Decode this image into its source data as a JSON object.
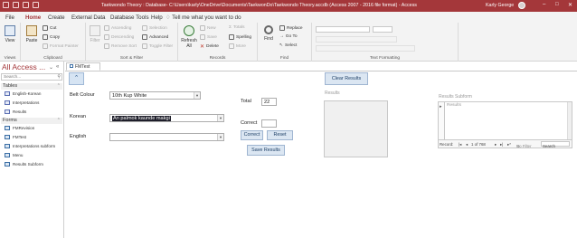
{
  "titlebar": {
    "title": "Taekwondo Theory : Database- C:\\Users\\karly\\OneDrive\\Documents\\TaekwonDo\\Taekwondo Theory.accdb (Access 2007 - 2016 file format) - Access",
    "user": "Karly George",
    "minimize": "–",
    "maximize": "□",
    "close": "✕"
  },
  "menu": {
    "tabs": [
      "File",
      "Home",
      "Create",
      "External Data",
      "Database Tools",
      "Help"
    ],
    "active": "Home",
    "tell_me": "Tell me what you want to do"
  },
  "ribbon": {
    "views": {
      "view": "View",
      "group": "Views"
    },
    "clipboard": {
      "paste": "Paste",
      "cut": "Cut",
      "copy": "Copy",
      "format_painter": "Format Painter",
      "group": "Clipboard"
    },
    "sort_filter": {
      "filter": "Filter",
      "ascending": "Ascending",
      "descending": "Descending",
      "remove_sort": "Remove Sort",
      "selection": "Selection",
      "advanced": "Advanced",
      "toggle_filter": "Toggle Filter",
      "group": "Sort & Filter"
    },
    "records": {
      "refresh": "Refresh",
      "refresh_all": "All",
      "new": "New",
      "save": "Save",
      "delete": "Delete",
      "totals": "Totals",
      "spelling": "Spelling",
      "more": "More",
      "group": "Records"
    },
    "find": {
      "find": "Find",
      "replace": "Replace",
      "goto": "Go To",
      "select": "Select",
      "group": "Find"
    },
    "text_formatting": {
      "group": "Text Formatting"
    }
  },
  "nav": {
    "title": "All Access ...",
    "search_placeholder": "Search...",
    "sections": [
      {
        "label": "Tables",
        "items": [
          "English-Korean",
          "Interpretations",
          "Results"
        ]
      },
      {
        "label": "Forms",
        "items": [
          "FMRevision",
          "FMTest",
          "Interpretations subform",
          "Menu",
          "Results Subform"
        ]
      }
    ]
  },
  "document": {
    "tab_label": "FMTest",
    "up_button": "⌃",
    "belt_colour": {
      "label": "Belt Colour",
      "value": "10th Kup White"
    },
    "korean": {
      "label": "Korean",
      "value": "An palmok kaunde makgi"
    },
    "english": {
      "label": "English",
      "value": ""
    },
    "total": {
      "label": "Total",
      "value": "22"
    },
    "correct": {
      "label": "Correct",
      "value": ""
    },
    "buttons": {
      "correct": "Correct",
      "reset": "Reset",
      "save_results": "Save Results",
      "clear_results": "Clear Results"
    },
    "results_label": "Results",
    "subform": {
      "label": "Results Subform",
      "column_header": "Results",
      "record_nav": {
        "label": "Record:",
        "position": "1 of 768",
        "filter": "No Filter",
        "search": "Search"
      }
    }
  },
  "colors": {
    "accent": "#a4373a",
    "button_fill": "#dbe6f2"
  }
}
